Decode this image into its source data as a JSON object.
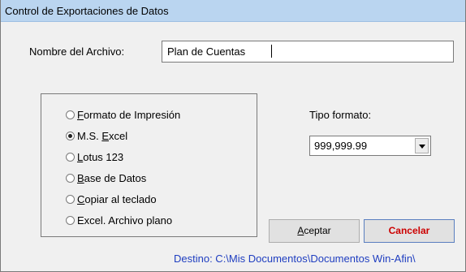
{
  "window": {
    "title": "Control de Exportaciones de Datos"
  },
  "file": {
    "label": "Nombre del Archivo:",
    "value": "Plan de Cuentas"
  },
  "formats": {
    "options": [
      {
        "label": "Formato de Impresión",
        "underline": "F",
        "rest": "ormato de Impresión",
        "selected": false
      },
      {
        "label": "M.S. Excel",
        "prefix": "M.S. ",
        "underline": "E",
        "rest": "xcel",
        "selected": true
      },
      {
        "label": "Lotus 123",
        "underline": "L",
        "rest": "otus 123",
        "selected": false
      },
      {
        "label": "Base de Datos",
        "underline": "B",
        "rest": "ase de Datos",
        "selected": false
      },
      {
        "label": "Copiar al teclado",
        "underline": "C",
        "rest": "opiar al teclado",
        "selected": false
      },
      {
        "label": "Excel. Archivo plano",
        "selected": false
      }
    ]
  },
  "tipo_formato": {
    "label": "Tipo formato:",
    "value": "999,999.99"
  },
  "buttons": {
    "accept_underline": "A",
    "accept_rest": "ceptar",
    "accept_label": "Aceptar",
    "cancel_label": "Cancelar"
  },
  "footer": {
    "destino": "Destino: C:\\Mis Documentos\\Documentos Win-Afin\\"
  },
  "colors": {
    "title_bar": "#bad5f0",
    "cancel_text": "#cc0000",
    "destino_text": "#1f3ec0"
  }
}
